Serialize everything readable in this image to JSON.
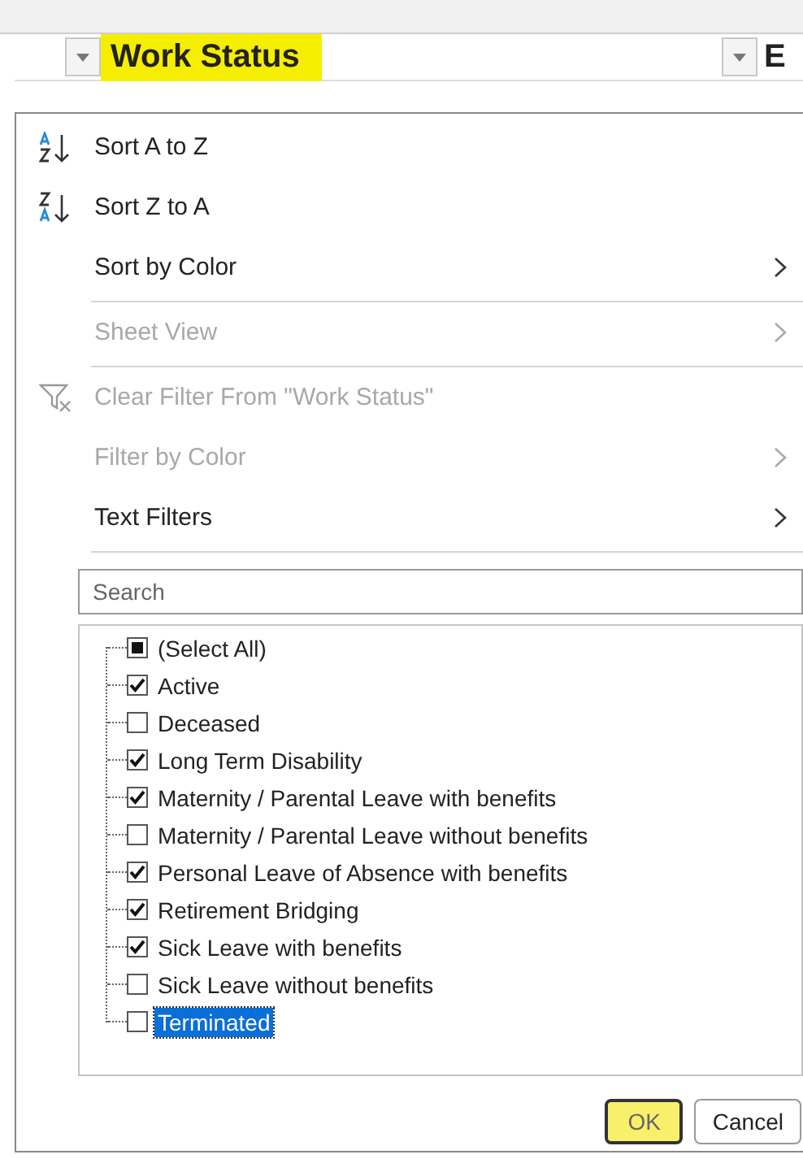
{
  "sheet": {
    "header": {
      "label": "Work Status",
      "highlighted": true
    },
    "next_header": "E"
  },
  "menu": {
    "items": [
      {
        "kind": "sort-asc",
        "label": "Sort A to Z",
        "disabled": false,
        "submenu": false,
        "separator_after": false
      },
      {
        "kind": "sort-desc",
        "label": "Sort Z to A",
        "disabled": false,
        "submenu": false,
        "separator_after": false
      },
      {
        "kind": "plain",
        "label": "Sort by Color",
        "disabled": false,
        "submenu": true,
        "separator_after": true
      },
      {
        "kind": "plain",
        "label": "Sheet View",
        "disabled": true,
        "submenu": true,
        "separator_after": true
      },
      {
        "kind": "clear-filter",
        "label": "Clear Filter From \"Work Status\"",
        "disabled": true,
        "submenu": false,
        "separator_after": false
      },
      {
        "kind": "plain",
        "label": "Filter by Color",
        "disabled": true,
        "submenu": true,
        "separator_after": false
      },
      {
        "kind": "plain",
        "label": "Text Filters",
        "disabled": false,
        "submenu": true,
        "separator_after": true
      }
    ],
    "search": {
      "placeholder": "Search"
    },
    "values": [
      {
        "label": "(Select All)",
        "checked": false,
        "indeterminate": true,
        "selected": false
      },
      {
        "label": "Active",
        "checked": true,
        "selected": false
      },
      {
        "label": "Deceased",
        "checked": false,
        "selected": false
      },
      {
        "label": "Long Term Disability",
        "checked": true,
        "selected": false
      },
      {
        "label": "Maternity / Parental Leave with benefits",
        "checked": true,
        "selected": false
      },
      {
        "label": "Maternity / Parental Leave without benefits",
        "checked": false,
        "selected": false
      },
      {
        "label": "Personal Leave of Absence with benefits",
        "checked": true,
        "selected": false
      },
      {
        "label": "Retirement Bridging",
        "checked": true,
        "selected": false
      },
      {
        "label": "Sick Leave with benefits",
        "checked": true,
        "selected": false
      },
      {
        "label": "Sick Leave without benefits",
        "checked": false,
        "selected": false
      },
      {
        "label": "Terminated",
        "checked": false,
        "selected": true
      }
    ],
    "buttons": [
      {
        "label": "OK",
        "highlighted": true
      },
      {
        "label": "Cancel",
        "highlighted": false
      }
    ]
  }
}
